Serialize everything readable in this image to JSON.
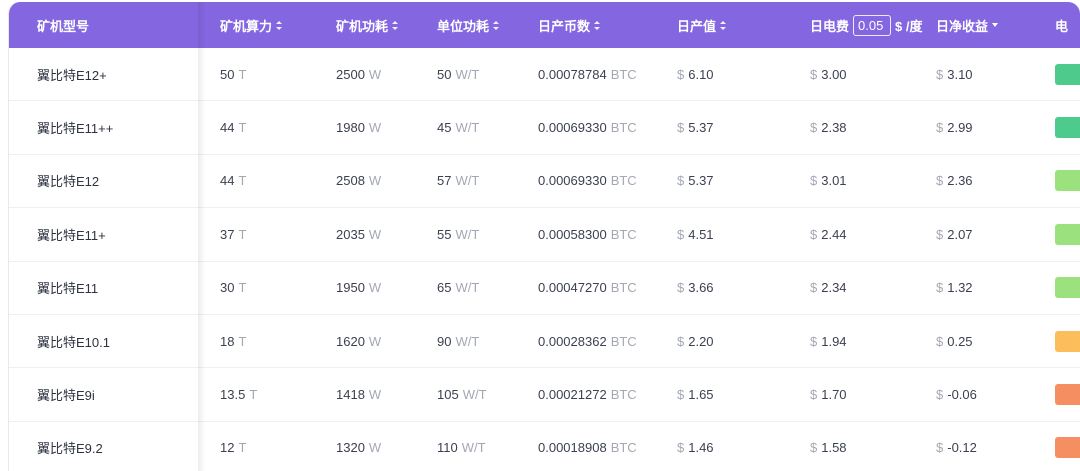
{
  "headers": {
    "model": "矿机型号",
    "hashrate": "矿机算力",
    "power": "矿机功耗",
    "efficiency": "单位功耗",
    "coins": "日产币数",
    "revenue": "日产值",
    "electricity": "日电费",
    "electricity_price": "0.05",
    "electricity_price_unit": "$ /度",
    "profit": "日净收益",
    "status": "电"
  },
  "icons": {
    "sort": "sort-icon",
    "sort_desc": "sort-desc-icon"
  },
  "units": {
    "hashrate": "T",
    "power": "W",
    "efficiency": "W/T",
    "coins": "BTC",
    "currency": "$"
  },
  "colors": {
    "header_bg": "#8466e1",
    "text": "#3b4150",
    "unit": "#a3a8b4"
  },
  "table": {
    "rows": [
      {
        "model": "翼比特E12+",
        "hashrate": "50",
        "power": "2500",
        "efficiency": "50",
        "coins": "0.00078784",
        "revenue": "6.10",
        "electricity": "3.00",
        "profit": "3.10",
        "status_color": "#4fca8d"
      },
      {
        "model": "翼比特E11++",
        "hashrate": "44",
        "power": "1980",
        "efficiency": "45",
        "coins": "0.00069330",
        "revenue": "5.37",
        "electricity": "2.38",
        "profit": "2.99",
        "status_color": "#4fca8d"
      },
      {
        "model": "翼比特E12",
        "hashrate": "44",
        "power": "2508",
        "efficiency": "57",
        "coins": "0.00069330",
        "revenue": "5.37",
        "electricity": "3.01",
        "profit": "2.36",
        "status_color": "#9be27e"
      },
      {
        "model": "翼比特E11+",
        "hashrate": "37",
        "power": "2035",
        "efficiency": "55",
        "coins": "0.00058300",
        "revenue": "4.51",
        "electricity": "2.44",
        "profit": "2.07",
        "status_color": "#9be27e"
      },
      {
        "model": "翼比特E11",
        "hashrate": "30",
        "power": "1950",
        "efficiency": "65",
        "coins": "0.00047270",
        "revenue": "3.66",
        "electricity": "2.34",
        "profit": "1.32",
        "status_color": "#9be27e"
      },
      {
        "model": "翼比特E10.1",
        "hashrate": "18",
        "power": "1620",
        "efficiency": "90",
        "coins": "0.00028362",
        "revenue": "2.20",
        "electricity": "1.94",
        "profit": "0.25",
        "status_color": "#fcbd5b"
      },
      {
        "model": "翼比特E9i",
        "hashrate": "13.5",
        "power": "1418",
        "efficiency": "105",
        "coins": "0.00021272",
        "revenue": "1.65",
        "electricity": "1.70",
        "profit": "-0.06",
        "status_color": "#f58f62"
      },
      {
        "model": "翼比特E9.2",
        "hashrate": "12",
        "power": "1320",
        "efficiency": "110",
        "coins": "0.00018908",
        "revenue": "1.46",
        "electricity": "1.58",
        "profit": "-0.12",
        "status_color": "#f58f62"
      }
    ]
  }
}
